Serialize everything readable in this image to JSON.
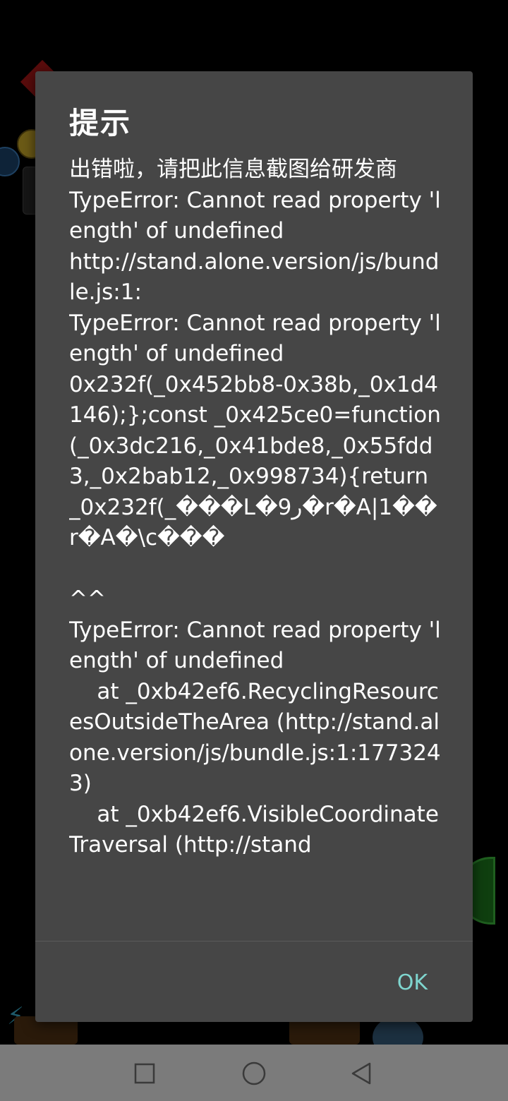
{
  "dialog": {
    "title": "提示",
    "message": "出错啦，请把此信息截图给研发商\nTypeError: Cannot read property 'length' of undefined\nhttp://stand.alone.version/js/bundle.js:1:\nTypeError: Cannot read property 'length' of undefined\n0x232f(_0x452bb8-0x38b,_0x1d4146);};const _0x425ce0=function(_0x3dc216,_0x41bde8,_0x55fdd3,_0x2bab12,_0x998734){return _0x232f(_���L�9ر�r�A|1��r�A�\\c���\n\n^^\nTypeError: Cannot read property 'length' of undefined\n    at _0xb42ef6.RecyclingResourcesOutsideTheArea (http://stand.alone.version/js/bundle.js:1:1773243)\n    at _0xb42ef6.VisibleCoordinateTraversal (http://stand",
    "ok_label": "OK"
  },
  "navbar": {
    "recent_icon": "square-icon",
    "home_icon": "circle-icon",
    "back_icon": "triangle-back-icon"
  },
  "colors": {
    "dialog_bg": "#464646",
    "accent": "#7fd6cf",
    "navbar_bg": "#7b7b7b"
  }
}
